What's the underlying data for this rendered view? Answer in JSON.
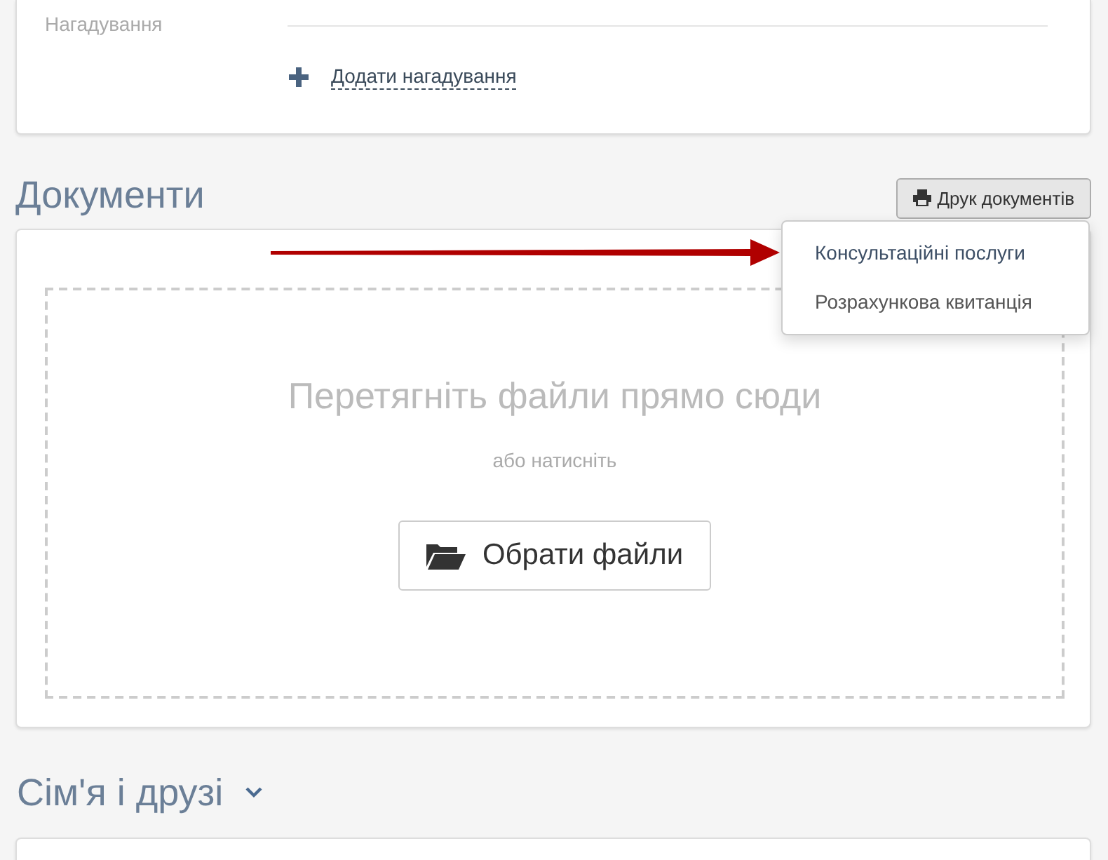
{
  "reminders": {
    "label": "Нагадування",
    "add_link": "Додати нагадування"
  },
  "documents": {
    "title": "Документи",
    "print_button": "Друк документів",
    "menu_open": true,
    "menu_items": [
      {
        "label": "Консультаційні послуги",
        "highlighted": true
      },
      {
        "label": "Розрахункова квитанція",
        "highlighted": false
      }
    ],
    "dropzone": {
      "title": "Перетягніть файли прямо сюди",
      "hint": "або натисніть",
      "button": "Обрати файли"
    }
  },
  "family": {
    "title": "Сім'я і друзі",
    "expanded": false
  }
}
